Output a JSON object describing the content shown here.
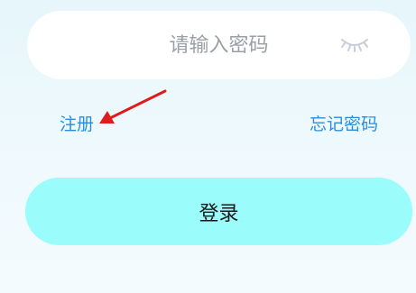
{
  "password_field": {
    "placeholder": "请输入密码",
    "visibility_icon": "eye-closed-icon"
  },
  "links": {
    "register": "注册",
    "forgot_password": "忘记密码"
  },
  "login_button": {
    "label": "登录"
  },
  "annotation": {
    "type": "arrow",
    "color": "#e01b1b",
    "points_to": "register-link"
  },
  "colors": {
    "link": "#2a8ee0",
    "button_bg": "#9afcfb",
    "placeholder": "#9aa0a6",
    "field_bg": "#ffffff",
    "page_bg_top": "#e6f6fb",
    "page_bg_bottom": "#f4fbfe"
  }
}
